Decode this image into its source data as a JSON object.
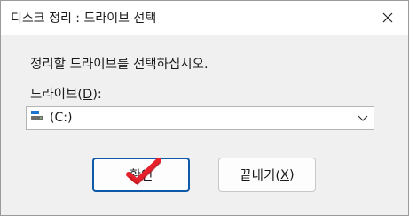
{
  "window": {
    "title": "디스크 정리 : 드라이브 선택"
  },
  "titlebar": {
    "close_icon": "close-icon"
  },
  "dialog": {
    "instruction": "정리할 드라이브를 선택하십시오.",
    "drive_label_prefix": "드라이브(",
    "drive_label_accel": "D",
    "drive_label_suffix": "):",
    "drive_select": {
      "selected_value": "(C:)",
      "icon": "drive-icon"
    }
  },
  "buttons": {
    "ok_label": "확인",
    "cancel_label_prefix": "끝내기(",
    "cancel_label_accel": "X",
    "cancel_label_suffix": ")"
  },
  "colors": {
    "accent": "#0e5aa8",
    "checkmark": "#e8202a"
  }
}
